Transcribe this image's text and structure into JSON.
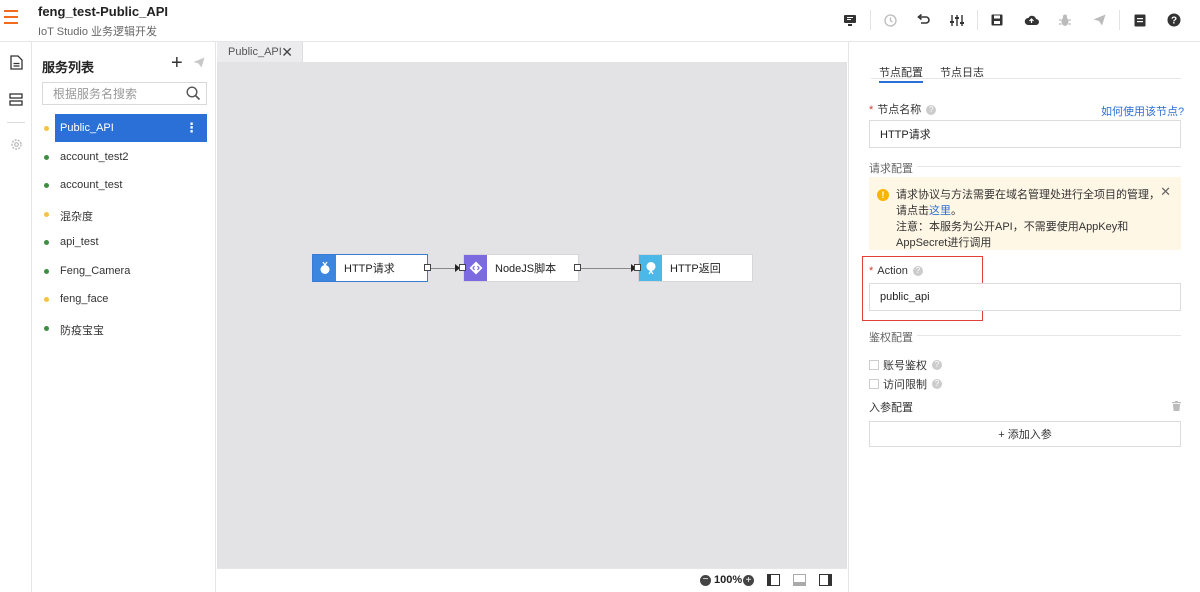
{
  "header": {
    "title": "feng_test-Public_API",
    "subtitle": "IoT Studio 业务逻辑开发"
  },
  "toolbar": {
    "icons": [
      "monitor-icon",
      "history-icon",
      "undo-icon",
      "settings-sliders-icon",
      "save-icon",
      "deploy-cloud-icon",
      "debug-bug-icon",
      "publish-send-icon",
      "document-icon",
      "help-icon"
    ],
    "disabled": [
      "history-icon",
      "debug-bug-icon",
      "publish-send-icon"
    ]
  },
  "service_panel": {
    "title": "服务列表",
    "search_placeholder": "根据服务名搜索",
    "items": [
      {
        "label": "Public_API",
        "status_color": "#f7c244",
        "active": true
      },
      {
        "label": "account_test2",
        "status_color": "#3e8e41",
        "active": false
      },
      {
        "label": "account_test",
        "status_color": "#3e8e41",
        "active": false
      },
      {
        "label": "混杂度",
        "status_color": "#f7c244",
        "active": false
      },
      {
        "label": "api_test",
        "status_color": "#3e8e41",
        "active": false
      },
      {
        "label": "Feng_Camera",
        "status_color": "#3e8e41",
        "active": false
      },
      {
        "label": "feng_face",
        "status_color": "#f7c244",
        "active": false
      },
      {
        "label": "防疫宝宝",
        "status_color": "#3e8e41",
        "active": false
      }
    ]
  },
  "canvas": {
    "tab_label": "Public_API",
    "nodes": [
      {
        "label": "HTTP请求",
        "icon": "http-request-icon",
        "color": "#3d86e0"
      },
      {
        "label": "NodeJS脚本",
        "icon": "code-icon",
        "color": "#7b6ae0"
      },
      {
        "label": "HTTP返回",
        "icon": "http-response-icon",
        "color": "#4bb8e8"
      }
    ],
    "zoom": "100%"
  },
  "node_config": {
    "tabs": [
      "节点配置",
      "节点日志"
    ],
    "node_name_label": "节点名称",
    "help_link": "如何使用该节点?",
    "node_name_value": "HTTP请求",
    "request_section": "请求配置",
    "alert_text_1": "请求协议与方法需要在域名管理处进行全项目的管理，请点击",
    "alert_link": "这里",
    "alert_text_2": "。",
    "alert_note": "注意：本服务为公开API，不需要使用AppKey和AppSecret进行调用",
    "action_label": "Action",
    "action_value": "public_api",
    "auth_section": "鉴权配置",
    "auth_options": [
      "账号鉴权",
      "访问限制"
    ],
    "params_label": "入参配置",
    "add_param_label": "+ 添加入参"
  },
  "colors": {
    "accent": "#2b70d6",
    "brand_orange": "#f26b1d",
    "highlight_red": "#e0413a"
  }
}
